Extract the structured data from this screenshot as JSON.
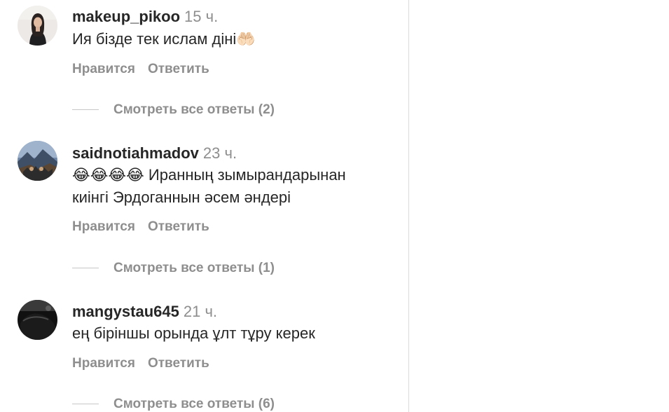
{
  "actions": {
    "like_label": "Нравится",
    "reply_label": "Ответить"
  },
  "comments": [
    {
      "username": "makeup_pikoo",
      "time": "15 ч.",
      "text": "Ия бізде тек ислам діні🤲🏻",
      "replies_label": "Смотреть все ответы (2)"
    },
    {
      "username": "saidnotiahmadov",
      "time": "23 ч.",
      "text": "😂😂😂😂 Иранның зымырандарынан\nкиінгі Эрдоганнын әсем әндері",
      "replies_label": "Смотреть все ответы (1)"
    },
    {
      "username": "mangystau645",
      "time": "21 ч.",
      "text": "ең біріншы орында ұлт тұру керек",
      "replies_label": "Смотреть все ответы (6)"
    }
  ]
}
